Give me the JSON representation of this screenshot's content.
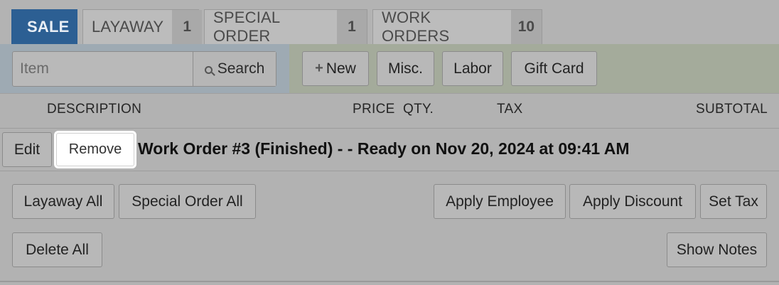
{
  "tabs": [
    {
      "label": "SALE",
      "count": ""
    },
    {
      "label": "LAYAWAY",
      "count": "1"
    },
    {
      "label": "SPECIAL ORDER",
      "count": "1"
    },
    {
      "label": "WORK ORDERS",
      "count": "10"
    }
  ],
  "search": {
    "placeholder": "Item",
    "button_label": "Search"
  },
  "actions": {
    "new_label": "New",
    "misc_label": "Misc.",
    "labor_label": "Labor",
    "gift_card_label": "Gift Card"
  },
  "columns": {
    "description": "DESCRIPTION",
    "price": "PRICE",
    "qty": "QTY.",
    "tax": "TAX",
    "subtotal": "SUBTOTAL"
  },
  "line_item": {
    "edit_label": "Edit",
    "remove_label": "Remove",
    "description": "Work Order #3 (Finished) - - Ready on Nov 20, 2024 at 09:41 AM"
  },
  "bulk_actions": {
    "layaway_all": "Layaway All",
    "special_order_all": "Special Order All",
    "apply_employee": "Apply Employee",
    "apply_discount": "Apply Discount",
    "set_tax": "Set Tax",
    "delete_all": "Delete All",
    "show_notes": "Show Notes"
  },
  "colors": {
    "active_tab": "#2c5f93",
    "search_panel": "#9eaab3",
    "action_panel": "#a4ab9b",
    "highlight": "#ffffff"
  },
  "icons": {
    "search": "search-icon",
    "new": "plus-icon"
  }
}
